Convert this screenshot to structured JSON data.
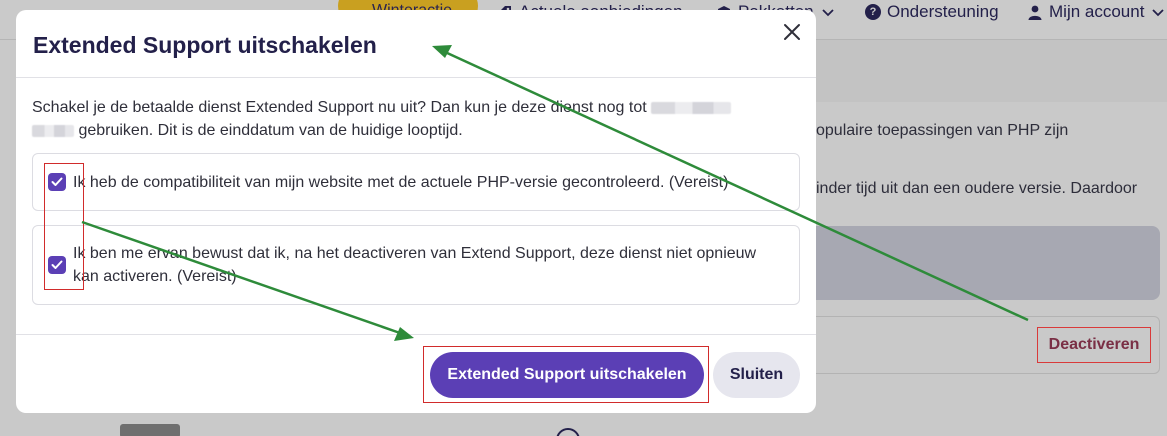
{
  "nav": {
    "promo_label": "Winteractie",
    "offers_label": "Actuele aanbiedingen",
    "packages_label": "Pakketten",
    "support_label": "Ondersteuning",
    "account_label": "Mijn account"
  },
  "background": {
    "text_line1": "opulaire toepassingen van PHP zijn",
    "text_line2": "inder tijd uit dan een oudere versie. Daardoor",
    "deactivate_label": "Deactiveren"
  },
  "modal": {
    "title": "Extended Support uitschakelen",
    "description_part1": "Schakel je de betaalde dienst Extended Support nu uit? Dan kun je deze dienst nog tot",
    "description_part2": "gebruiken. Dit is de einddatum van de huidige looptijd.",
    "checkbox1_label": "Ik heb de compatibiliteit van mijn website met de actuele PHP-versie gecontroleerd. (Vereist)",
    "checkbox2_label": "Ik ben me ervan bewust dat ik, na het deactiveren van Extend Support, deze dienst niet opnieuw kan activeren. (Vereist)",
    "confirm_label": "Extended Support uitschakelen",
    "close_label": "Sluiten"
  },
  "colors": {
    "accent": "#5b3fb5",
    "annotation_red": "#d12b2b",
    "annotation_arrow": "#2e8b3a"
  }
}
